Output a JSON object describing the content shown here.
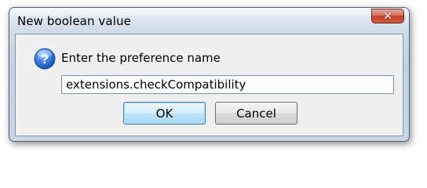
{
  "dialog": {
    "title": "New boolean value",
    "close_glyph": "✕",
    "prompt": "Enter the preference name",
    "input_value": "extensions.checkCompatibility",
    "ok_label": "OK",
    "cancel_label": "Cancel",
    "icon": "question-icon"
  },
  "colors": {
    "icon_blue": "#2f6fd6",
    "close_red": "#c3412a",
    "default_button_border": "#3c7fb1"
  }
}
